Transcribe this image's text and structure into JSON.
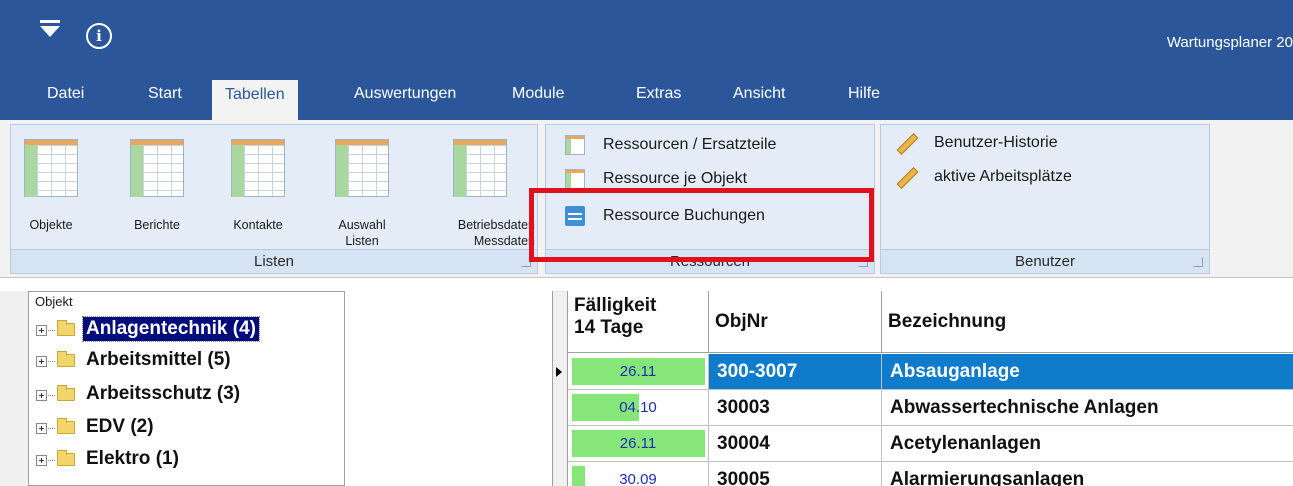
{
  "window": {
    "title": "Wartungsplaner 20"
  },
  "menu": {
    "items": [
      "Datei",
      "Start",
      "Tabellen",
      "Auswertungen",
      "Module",
      "Extras",
      "Ansicht",
      "Hilfe"
    ],
    "active": "Tabellen"
  },
  "ribbon": {
    "listen": {
      "label": "Listen",
      "buttons": [
        "Objekte",
        "Berichte",
        "Kontakte",
        "Auswahl\nListen",
        "Betriebsdaten\nMessdaten"
      ]
    },
    "ressourcen": {
      "label": "Ressourcen",
      "buttons": [
        "Ressourcen / Ersatzteile",
        "Ressource je Objekt",
        "Ressource Buchungen"
      ]
    },
    "benutzer": {
      "label": "Benutzer",
      "buttons": [
        "Benutzer-Historie",
        "aktive Arbeitsplätze"
      ]
    }
  },
  "tree": {
    "header": "Objekt",
    "items": [
      {
        "label": "Anlagentechnik  (4)",
        "selected": true
      },
      {
        "label": "Arbeitsmittel  (5)"
      },
      {
        "label": "Arbeitsschutz  (3)"
      },
      {
        "label": "EDV  (2)"
      },
      {
        "label": "Elektro  (1)"
      }
    ]
  },
  "grid": {
    "columns": [
      "Fälligkeit\n14 Tage",
      "ObjNr",
      "Bezeichnung"
    ],
    "rows": [
      {
        "due": "26.11",
        "due_fill": 1.0,
        "objnr": "300-3007",
        "bezeichnung": "Absauganlage",
        "selected": true
      },
      {
        "due": "04.10",
        "due_fill": 0.5,
        "objnr": "30003",
        "bezeichnung": "Abwassertechnische Anlagen"
      },
      {
        "due": "26.11",
        "due_fill": 1.0,
        "objnr": "30004",
        "bezeichnung": "Acetylenanlagen"
      },
      {
        "due": "30.09",
        "due_fill": 0.1,
        "objnr": "30005",
        "bezeichnung": "Alarmierungsanlagen"
      }
    ]
  },
  "colors": {
    "titlebar": "#2b579a",
    "selection": "#0f7bcb",
    "highlight": "#e0101e",
    "due_bar": "#86e67a"
  }
}
